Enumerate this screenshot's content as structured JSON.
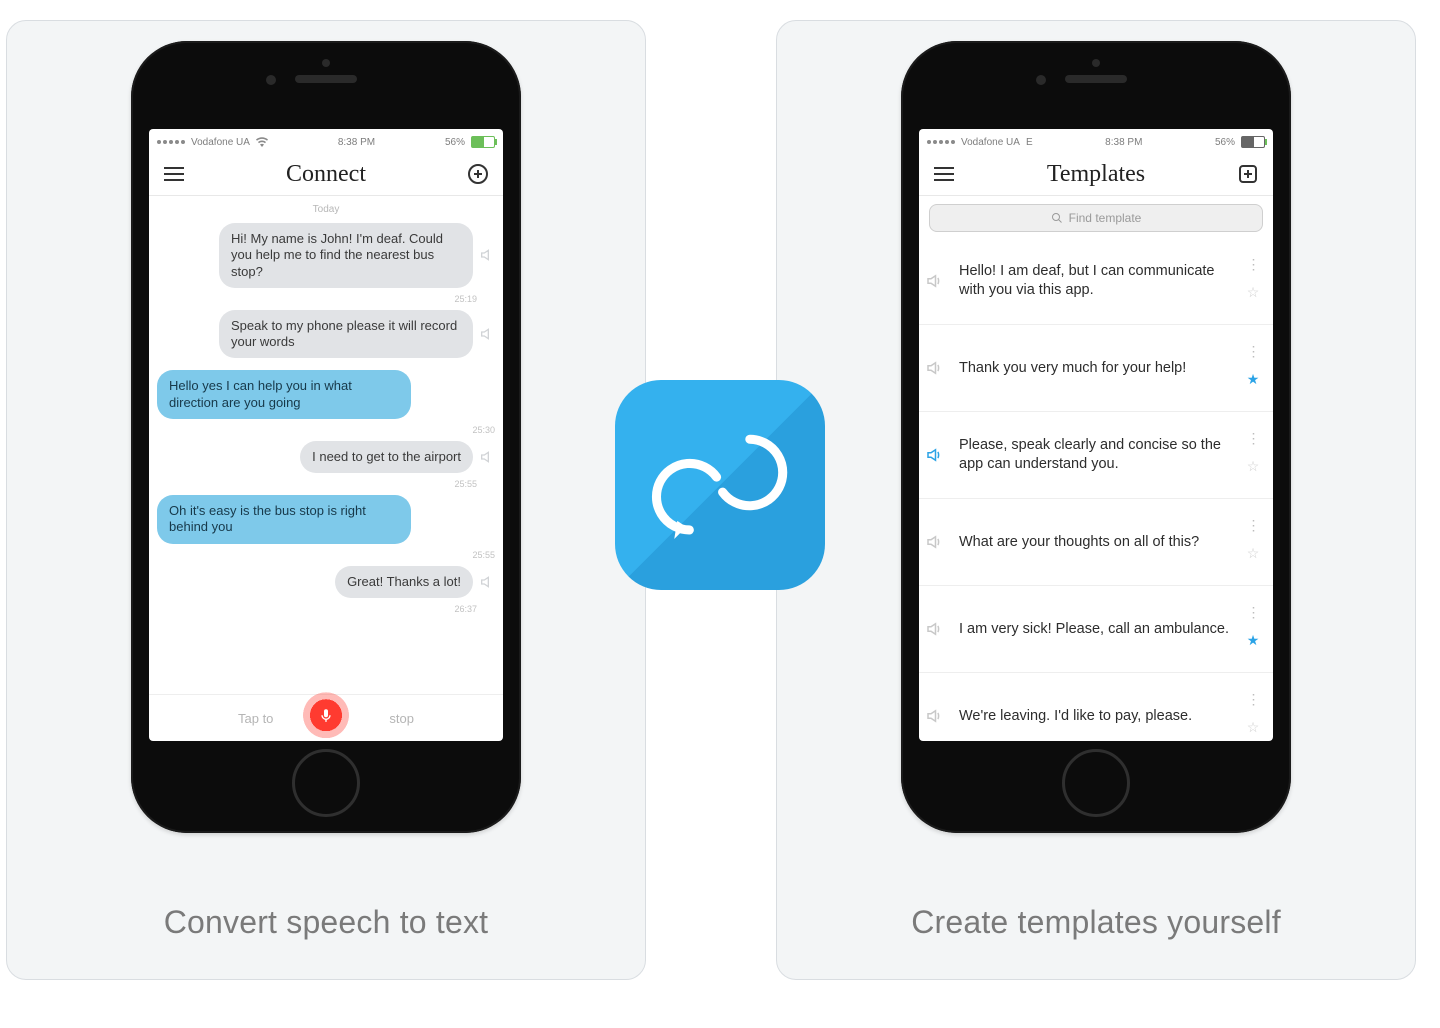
{
  "statusbar": {
    "carrier": "Vodafone UA",
    "time": "8:38 PM",
    "battery_pct": "56%"
  },
  "left": {
    "caption": "Convert speech to text",
    "header": {
      "title": "Connect"
    },
    "day_label": "Today",
    "messages": [
      {
        "side": "right",
        "text": "Hi! My name is John! I'm deaf. Could you help me to find the nearest bus stop?",
        "time": "25:19"
      },
      {
        "side": "right",
        "text": "Speak to my phone please it will record your words",
        "time": ""
      },
      {
        "side": "left",
        "text": "Hello yes I can help you in what direction are you going",
        "time": "25:30"
      },
      {
        "side": "right",
        "text": "I need to get to the airport",
        "time": "25:55"
      },
      {
        "side": "left",
        "text": "Oh it's easy is the bus stop is right behind you",
        "time": "25:55"
      },
      {
        "side": "right",
        "text": "Great! Thanks a lot!",
        "time": "26:37"
      }
    ],
    "tapbar": {
      "left": "Tap to",
      "right": "stop"
    }
  },
  "right": {
    "caption": "Create templates yourself",
    "header": {
      "title": "Templates"
    },
    "search_placeholder": "Find template",
    "templates": [
      {
        "text": "Hello! I am deaf, but I can communicate with you via this app.",
        "starred": false,
        "playing": false
      },
      {
        "text": "Thank you very much for your help!",
        "starred": true,
        "playing": false
      },
      {
        "text": "Please, speak clearly and concise so the app can understand you.",
        "starred": false,
        "playing": true
      },
      {
        "text": "What are your thoughts on all of this?",
        "starred": false,
        "playing": false
      },
      {
        "text": "I am very sick! Please, call an ambulance.",
        "starred": true,
        "playing": false
      },
      {
        "text": "We're leaving. I'd like to pay, please.",
        "starred": false,
        "playing": false
      }
    ]
  },
  "colors": {
    "brand": "#2ba3e6"
  }
}
